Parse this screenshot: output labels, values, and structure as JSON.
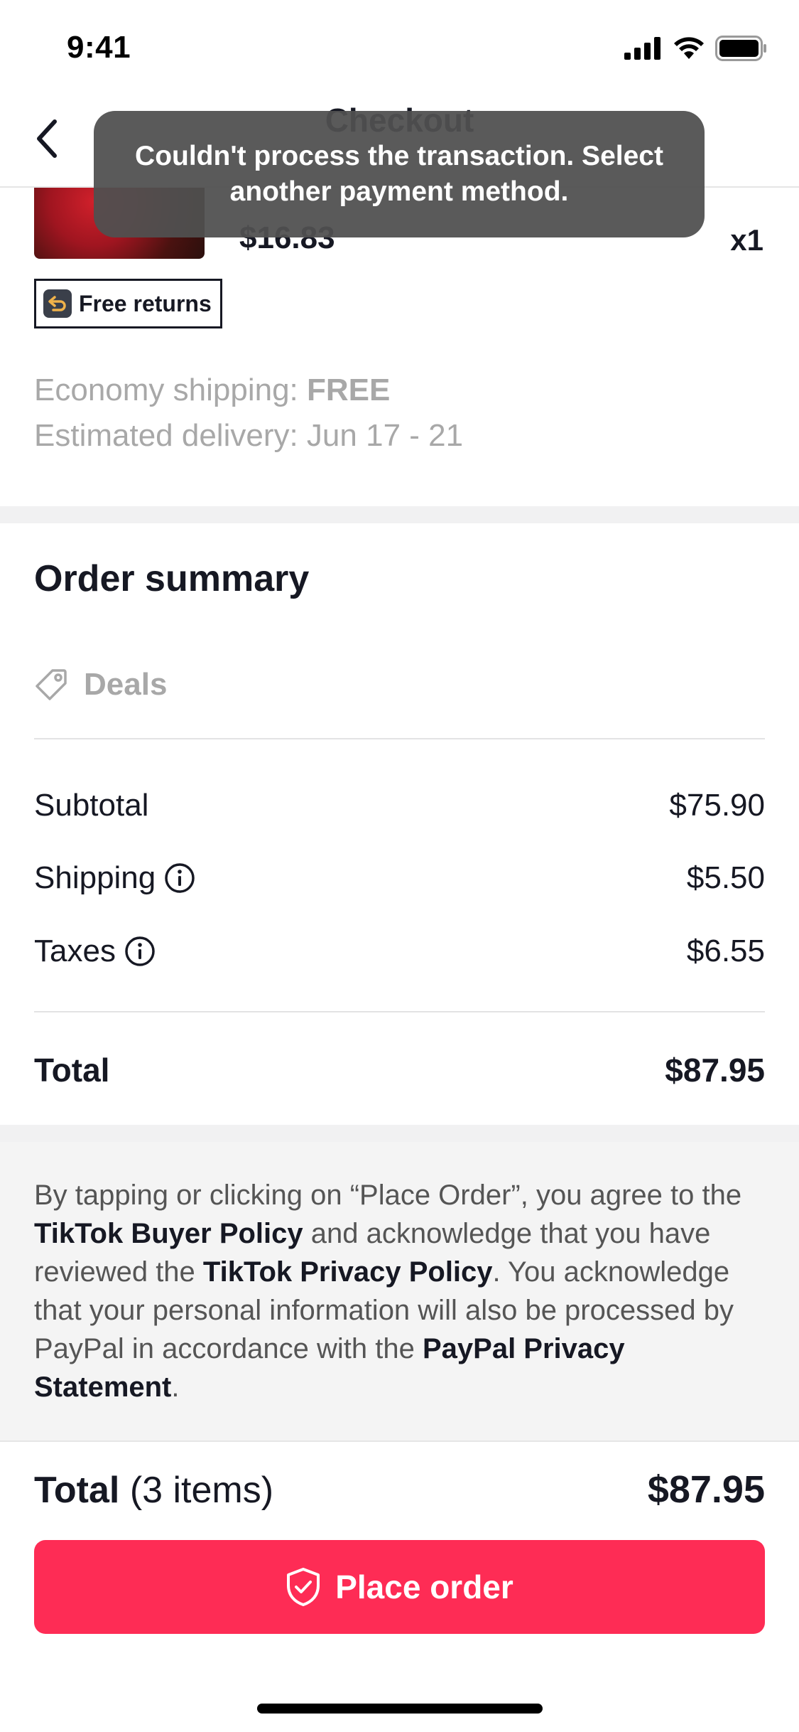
{
  "status_bar": {
    "time": "9:41"
  },
  "header": {
    "title": "Checkout"
  },
  "product": {
    "price": "$16.83",
    "quantity": "x1",
    "badge": "Free returns"
  },
  "shipping": {
    "method_label": "Economy shipping:",
    "method_value": "FREE",
    "delivery": "Estimated delivery: Jun 17 - 21"
  },
  "summary": {
    "title": "Order summary",
    "deals_label": "Deals",
    "rows": [
      {
        "label": "Subtotal",
        "value": "$75.90"
      },
      {
        "label": "Shipping",
        "value": "$5.50"
      },
      {
        "label": "Taxes",
        "value": "$6.55"
      }
    ],
    "total_label": "Total",
    "total_value": "$87.95"
  },
  "legal": {
    "p1": "By tapping or clicking on “Place Order”, you agree to the ",
    "buyer_policy": "TikTok Buyer Policy",
    "p2": " and acknowledge that you have reviewed the ",
    "privacy_policy": "TikTok Privacy Policy",
    "p3": ". You acknowledge that your personal information will also be processed by PayPal in accordance with the ",
    "paypal_statement": "PayPal Privacy Statement",
    "p4": "."
  },
  "footer": {
    "total_label": "Total",
    "items_label": "(3 items)",
    "total_value": "$87.95",
    "place_order_label": "Place order"
  },
  "toast": {
    "message": "Couldn't process the transaction. Select another payment method."
  },
  "colors": {
    "accent": "#fe2c55",
    "muted_text": "#a8a8a8",
    "toast_bg": "#505050"
  }
}
